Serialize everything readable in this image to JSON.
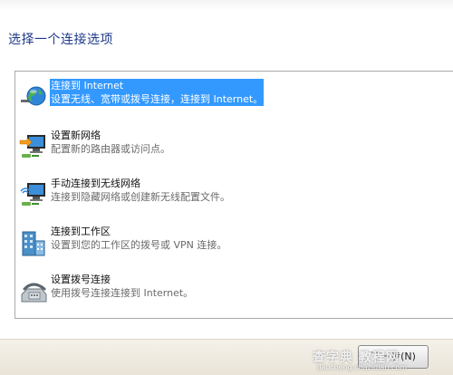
{
  "dialog": {
    "heading": "选择一个连接选项",
    "options": [
      {
        "title": "连接到 Internet",
        "desc": "设置无线、宽带或拨号连接，连接到 Internet。",
        "icon": "globe-network-icon",
        "selected": true
      },
      {
        "title": "设置新网络",
        "desc": "配置新的路由器或访问点。",
        "icon": "new-network-icon",
        "selected": false
      },
      {
        "title": "手动连接到无线网络",
        "desc": "连接到隐藏网络或创建新无线配置文件。",
        "icon": "wireless-network-icon",
        "selected": false
      },
      {
        "title": "连接到工作区",
        "desc": "设置到您的工作区的拨号或 VPN 连接。",
        "icon": "workplace-icon",
        "selected": false
      },
      {
        "title": "设置拨号连接",
        "desc": "使用拨号连接连接到 Internet。",
        "icon": "dialup-phone-icon",
        "selected": false
      }
    ],
    "next_button": "下一步(N)"
  },
  "watermark": {
    "text": "查字典 教程网",
    "url": "jiaocheng.chazidian.com"
  },
  "colors": {
    "selection": "#3399ff",
    "heading": "#1e3a8a"
  }
}
